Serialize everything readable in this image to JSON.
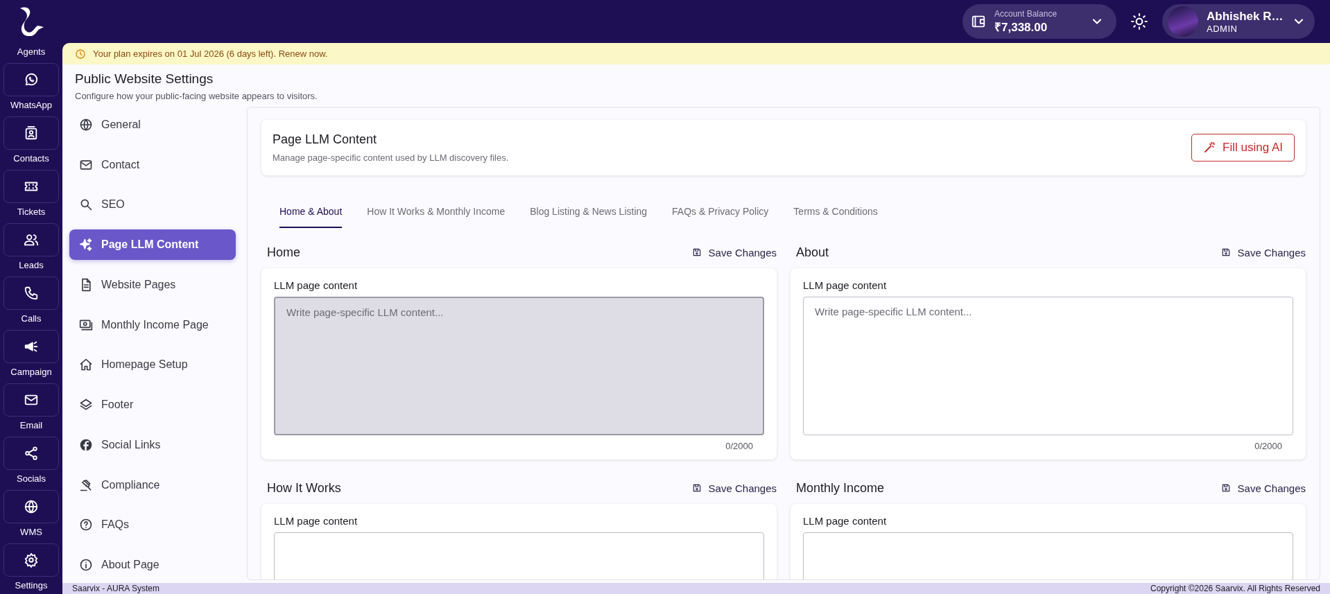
{
  "top_bar": {
    "balance_label": "Account Balance",
    "balance": "₹7,338.00",
    "user_name": "Abhishek R…",
    "user_role": "ADMIN"
  },
  "rail": {
    "logo_label": "Agents",
    "items": [
      {
        "label": "WhatsApp"
      },
      {
        "label": "Contacts"
      },
      {
        "label": "Tickets"
      },
      {
        "label": "Leads"
      },
      {
        "label": "Calls"
      },
      {
        "label": "Campaign"
      },
      {
        "label": "Email"
      },
      {
        "label": "Socials"
      },
      {
        "label": "WMS"
      },
      {
        "label": "Settings"
      }
    ]
  },
  "banner": "Your plan expires on 01 Jul 2026 (6 days left). Renew now.",
  "page": {
    "title": "Public Website Settings",
    "subtitle": "Configure how your public-facing website appears to visitors."
  },
  "settings_nav": [
    {
      "label": "General",
      "selected": false
    },
    {
      "label": "Contact",
      "selected": false
    },
    {
      "label": "SEO",
      "selected": false
    },
    {
      "label": "Page LLM Content",
      "selected": true
    },
    {
      "label": "Website Pages",
      "selected": false
    },
    {
      "label": "Monthly Income Page",
      "selected": false
    },
    {
      "label": "Homepage Setup",
      "selected": false
    },
    {
      "label": "Footer",
      "selected": false
    },
    {
      "label": "Social Links",
      "selected": false
    },
    {
      "label": "Compliance",
      "selected": false
    },
    {
      "label": "FAQs",
      "selected": false
    },
    {
      "label": "About Page",
      "selected": false
    }
  ],
  "panel": {
    "title": "Page LLM Content",
    "subtitle": "Manage page-specific content used by LLM discovery files.",
    "action": "Fill using AI",
    "tabs": [
      {
        "label": "Home & About",
        "selected": true
      },
      {
        "label": "How It Works & Monthly Income",
        "selected": false
      },
      {
        "label": "Blog Listing & News Listing",
        "selected": false
      },
      {
        "label": "FAQs & Privacy Policy",
        "selected": false
      },
      {
        "label": "Terms & Conditions",
        "selected": false
      }
    ],
    "sections": [
      {
        "title": "Home",
        "save": "Save Changes",
        "field_label": "LLM page content",
        "placeholder": "Write page-specific LLM content...",
        "counter": "0/2000",
        "disabled": true
      },
      {
        "title": "About",
        "save": "Save Changes",
        "field_label": "LLM page content",
        "placeholder": "Write page-specific LLM content...",
        "counter": "0/2000",
        "disabled": false
      },
      {
        "title": "How It Works",
        "save": "Save Changes",
        "field_label": "LLM page content",
        "disabled": false
      },
      {
        "title": "Monthly Income",
        "save": "Save Changes",
        "field_label": "LLM page content",
        "disabled": false
      }
    ]
  },
  "footer": {
    "left": "Saarvix - AURA System",
    "right": "Copyright ©2026 Saarvix. All Rights Reserved"
  }
}
